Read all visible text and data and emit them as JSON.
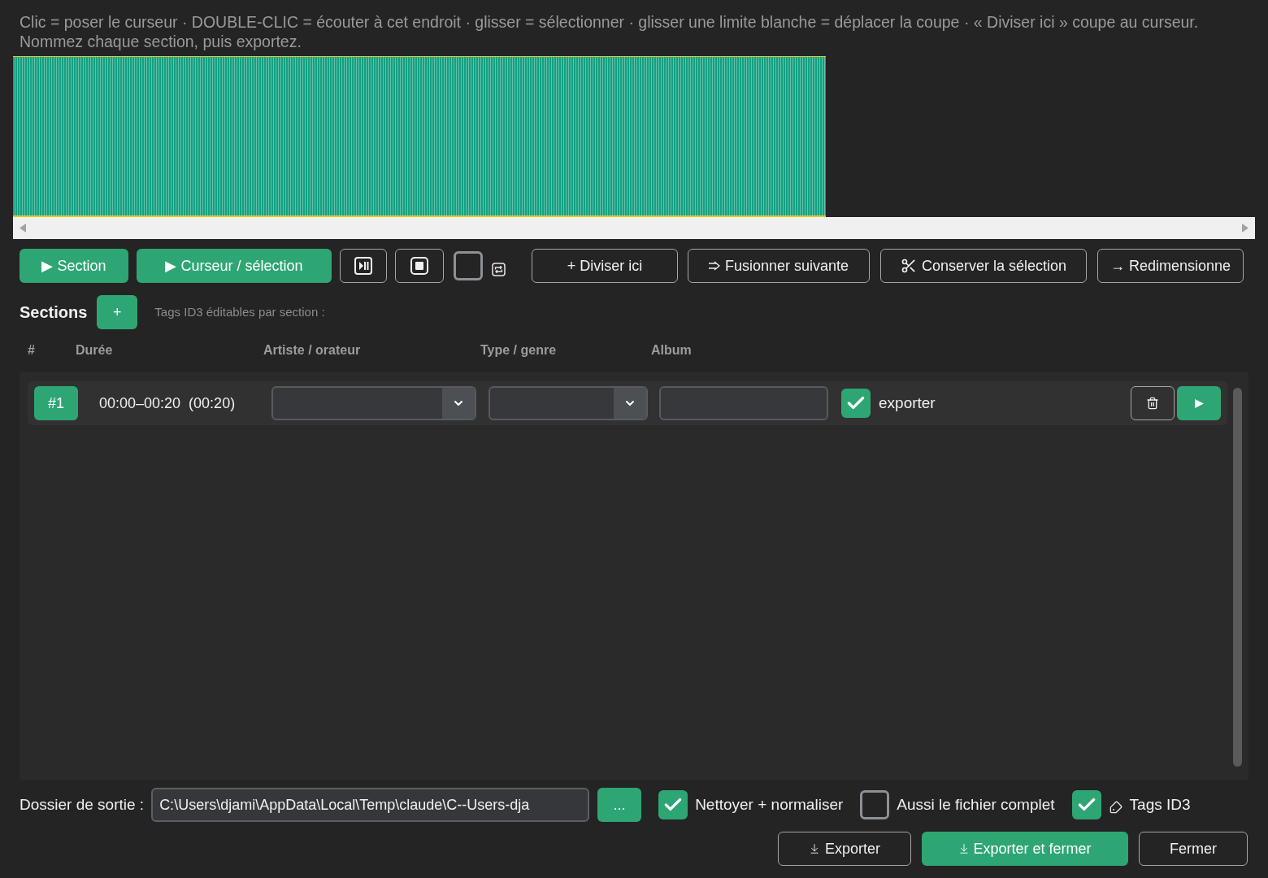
{
  "instructions": [
    "Clic = poser le curseur · DOUBLE-CLIC = écouter à cet endroit · glisser = sélectionner · glisser une limite blanche = déplacer la coupe · « Diviser ici » coupe au curseur.",
    "Nommez chaque section, puis exportez."
  ],
  "toolbar": {
    "play_section": {
      "label": "▶ Section"
    },
    "play_cursor": {
      "label": "▶ Curseur / sélection"
    },
    "loop": {
      "checked": false
    },
    "split": {
      "label": "+ Diviser ici"
    },
    "merge": {
      "label": "Fusionner suivante"
    },
    "keep_selection": {
      "label": "Conserver la sélection"
    },
    "resize": {
      "label": "→ Redimensionne"
    }
  },
  "sections": {
    "title": "Sections",
    "add_label": "+",
    "hint": "Tags ID3 éditables par section :",
    "columns": [
      "#",
      "Durée",
      "Artiste / orateur",
      "Type / genre",
      "Album"
    ],
    "rows": [
      {
        "number": "#1",
        "duration": "00:00–00:20  (00:20)",
        "export": {
          "label": "exporter",
          "checked": true
        }
      }
    ]
  },
  "output": {
    "label": "Dossier de sortie :",
    "path": "C:\\Users\\djami\\AppData\\Local\\Temp\\claude\\C--Users-dja",
    "browse_label": "..."
  },
  "options": [
    {
      "kind": "plain",
      "label": "Nettoyer + normaliser",
      "checked": true
    },
    {
      "kind": "plain",
      "label": "Aussi le fichier complet",
      "checked": false
    },
    {
      "kind": "tags",
      "label": "Tags ID3",
      "checked": true
    }
  ],
  "actions": [
    {
      "kind": "download",
      "label": "Exporter",
      "primary": false
    },
    {
      "kind": "download",
      "label": "Exporter et fermer",
      "primary": true
    },
    {
      "kind": "plain",
      "label": "Fermer",
      "primary": false
    }
  ]
}
